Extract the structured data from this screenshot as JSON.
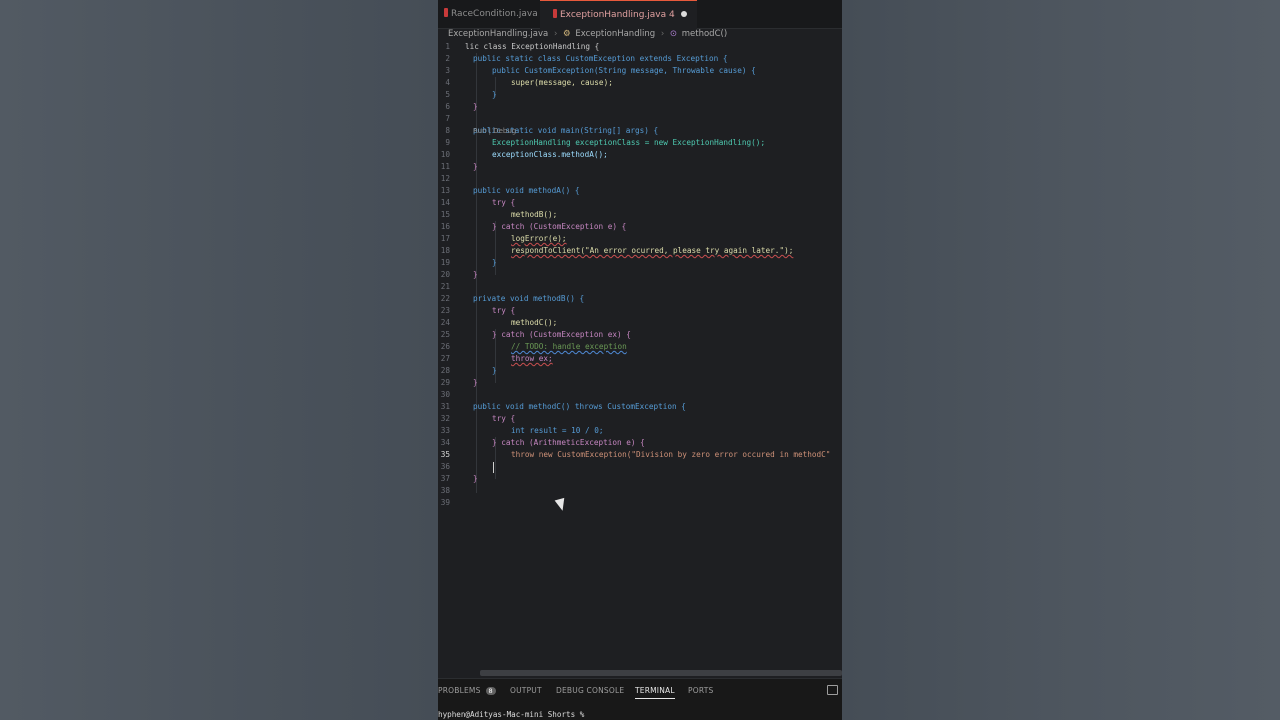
{
  "tabs": [
    {
      "label": "RaceCondition.java",
      "active": false
    },
    {
      "label": "ExceptionHandling.java 4",
      "active": true,
      "dirty": true
    }
  ],
  "breadcrumb": {
    "file": "ExceptionHandling.java",
    "class": "ExceptionHandling",
    "method": "methodC()"
  },
  "codelens": "Run | Debug",
  "code": {
    "l1": "lic class ExceptionHandling {",
    "l2": "public static class CustomException extends Exception {",
    "l3": "public CustomException(String message, Throwable cause) {",
    "l4": "super(message, cause);",
    "l5": "}",
    "l6": "}",
    "l8": "public static void main(String[] args) {",
    "l9": "ExceptionHandling exceptionClass = new ExceptionHandling();",
    "l10": "exceptionClass.methodA();",
    "l11": "}",
    "l13": "public void methodA() {",
    "l14": "try {",
    "l15": "methodB();",
    "l16": "} catch (CustomException e) {",
    "l17": "logError(e);",
    "l18": "respondToClient(\"An error ocurred, please try again later.\");",
    "l19": "}",
    "l20": "}",
    "l22": "private void methodB() {",
    "l23": "try {",
    "l24": "methodC();",
    "l25": "} catch (CustomException ex) {",
    "l26": "// TODO: handle exception",
    "l27": "throw ex;",
    "l28": "}",
    "l29": "}",
    "l31": "public void methodC() throws CustomException {",
    "l32": "try {",
    "l33": "int result = 10 / 0;",
    "l34": "} catch (ArithmeticException e) {",
    "l35": "throw new CustomException(\"Division by zero error occured in methodC\"",
    "l37": "}"
  },
  "line_numbers": [
    "1",
    "2",
    "3",
    "4",
    "5",
    "6",
    "7",
    "8",
    "9",
    "10",
    "11",
    "12",
    "13",
    "14",
    "15",
    "16",
    "17",
    "18",
    "19",
    "20",
    "21",
    "22",
    "23",
    "24",
    "25",
    "26",
    "27",
    "28",
    "29",
    "30",
    "31",
    "32",
    "33",
    "34",
    "35",
    "36",
    "37",
    "38",
    "39"
  ],
  "current_line": "35",
  "panel": {
    "tabs": [
      "PROBLEMS",
      "OUTPUT",
      "DEBUG CONSOLE",
      "TERMINAL",
      "PORTS"
    ],
    "problems_count": "8",
    "active_tab": "TERMINAL",
    "prompt": "hyphen@Adityas-Mac-mini Shorts %"
  }
}
